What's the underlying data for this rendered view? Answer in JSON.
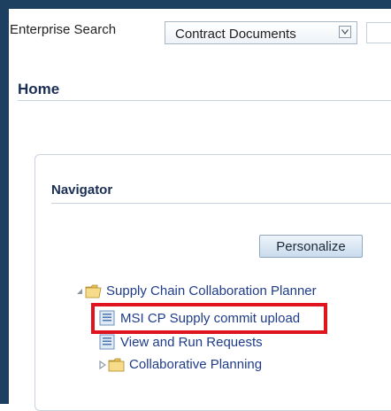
{
  "search": {
    "label": "Enterprise Search",
    "selected": "Contract Documents"
  },
  "page": {
    "title": "Home"
  },
  "navigator": {
    "title": "Navigator",
    "personalize_label": "Personalize",
    "tree": [
      {
        "label": "Supply Chain Collaboration Planner",
        "type": "folder",
        "expanded": true
      },
      {
        "label": "MSI CP Supply commit upload",
        "type": "page",
        "highlighted": true
      },
      {
        "label": "View and Run Requests",
        "type": "page"
      },
      {
        "label": "Collaborative Planning",
        "type": "folder",
        "expanded": false
      }
    ]
  },
  "colors": {
    "frame": "#1e4060",
    "heading": "#1a2e55",
    "link": "#1f3c88",
    "highlight": "#e0141e"
  }
}
